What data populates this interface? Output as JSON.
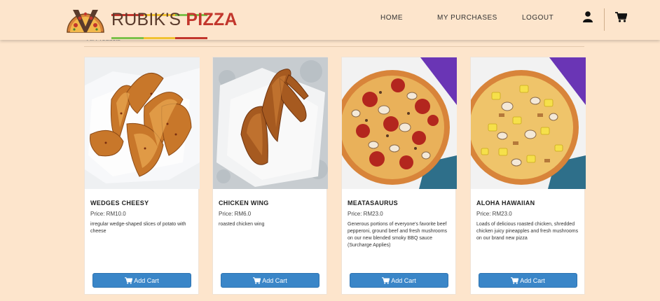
{
  "brand": {
    "name_light": "RUBIK'S",
    "name_bold": "PIZZA",
    "colors": {
      "red": "#c2362c",
      "green": "#7cc14a",
      "yellow": "#f1c232",
      "dark": "#5a3b2c"
    }
  },
  "nav": {
    "home": "HOME",
    "purchases": "MY PURCHASES",
    "logout": "LOGOUT",
    "user_icon": "user-icon",
    "cart_icon": "shopping-cart-icon"
  },
  "breadcrumb": "All Products",
  "add_cart_label": "Add Cart",
  "accent_color": "#3a86c8",
  "products": [
    {
      "name": "WEDGES CHEESY",
      "price": "Price: RM10.0",
      "description": "irregular wedge-shaped slices of potato with cheese",
      "image": "potato-wedges-photo"
    },
    {
      "name": "CHICKEN WING",
      "price": "Price: RM6.0",
      "description": "roasted chicken wing",
      "image": "chicken-wing-photo"
    },
    {
      "name": "MEATASAURUS",
      "price": "Price: RM23.0",
      "description": "Generous portions of everyone's favorite beef pepperoni, ground beef and fresh mushrooms on our new blended smoky BBQ sauce (Surcharge Applies)",
      "image": "meatasaurus-pizza-photo"
    },
    {
      "name": "ALOHA HAWAIIAN",
      "price": "Price: RM23.0",
      "description": "Loads of delicious roasted chicken, shredded chicken juicy pineapples and fresh mushrooms on our brand new pizza",
      "image": "aloha-hawaiian-pizza-photo"
    }
  ]
}
